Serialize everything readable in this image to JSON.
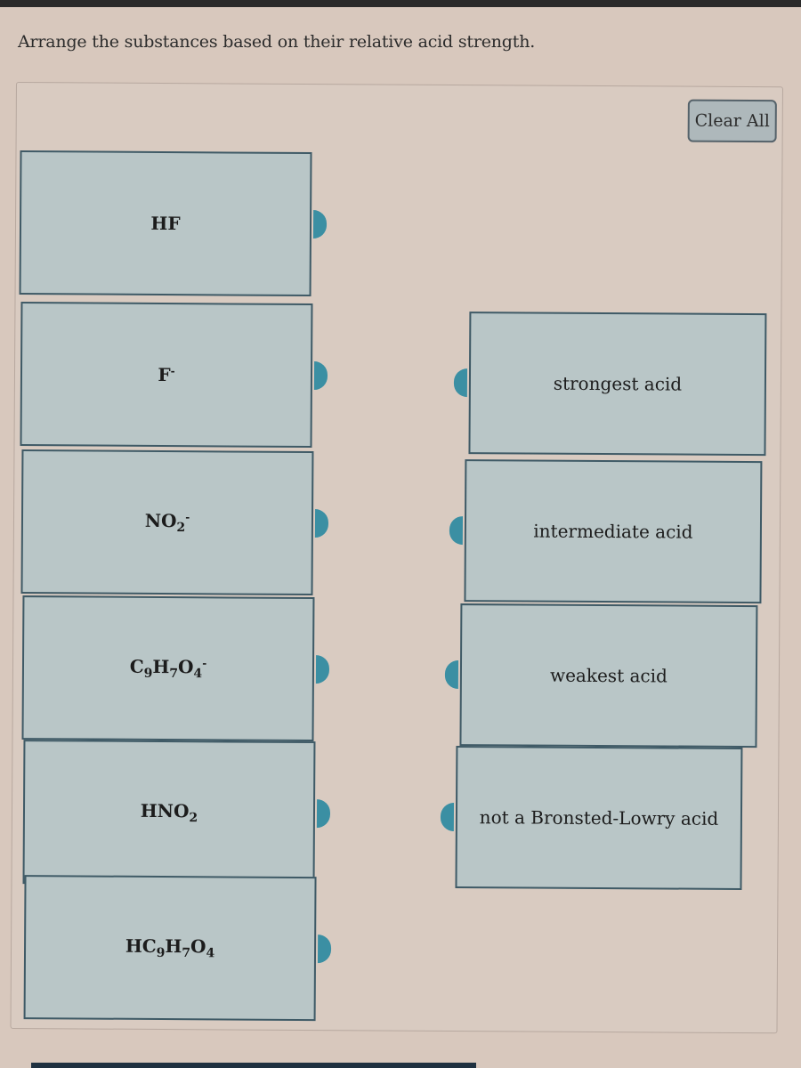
{
  "question": "Arrange the substances based on their relative acid strength.",
  "clear_all_label": "Clear All",
  "substances": [
    {
      "id": "HF",
      "parts": [
        {
          "t": "HF"
        }
      ]
    },
    {
      "id": "F-",
      "parts": [
        {
          "t": "F"
        },
        {
          "sup": "-"
        }
      ]
    },
    {
      "id": "NO2-",
      "parts": [
        {
          "t": "NO"
        },
        {
          "sub": "2"
        },
        {
          "sup": "-"
        }
      ]
    },
    {
      "id": "C9H7O4-",
      "parts": [
        {
          "t": "C"
        },
        {
          "sub": "9"
        },
        {
          "t": "H"
        },
        {
          "sub": "7"
        },
        {
          "t": "O"
        },
        {
          "sub": "4"
        },
        {
          "sup": "-"
        }
      ]
    },
    {
      "id": "HNO2",
      "parts": [
        {
          "t": "HNO"
        },
        {
          "sub": "2"
        }
      ]
    },
    {
      "id": "HC9H7O4",
      "parts": [
        {
          "t": "HC"
        },
        {
          "sub": "9"
        },
        {
          "t": "H"
        },
        {
          "sub": "7"
        },
        {
          "t": "O"
        },
        {
          "sub": "4"
        }
      ]
    }
  ],
  "categories": [
    "strongest acid",
    "intermediate acid",
    "weakest acid",
    "not a Bronsted-Lowry acid"
  ],
  "colors": {
    "connector": "#3b8fa3",
    "box_fill": "#b9c6c7",
    "box_border": "#3f5a66",
    "background": "#d8c8bd"
  }
}
